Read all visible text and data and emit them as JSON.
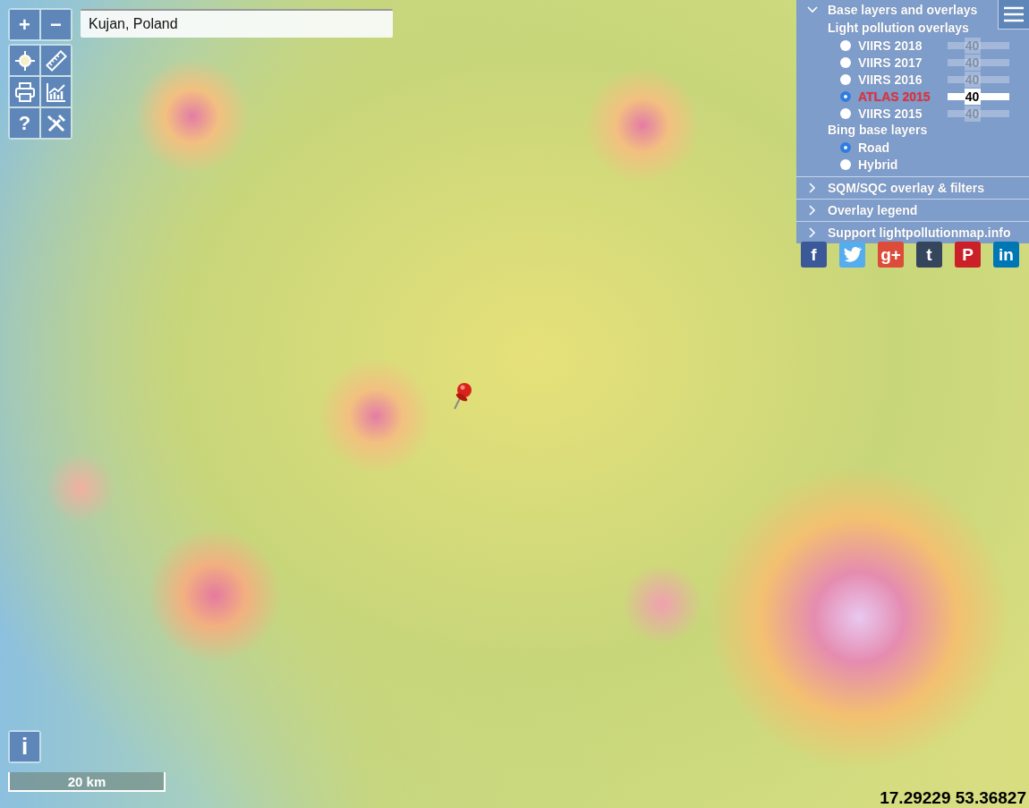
{
  "search": {
    "value": "Kujan, Poland"
  },
  "zoom": {
    "in_label": "+",
    "out_label": "−"
  },
  "tools": {
    "help_label": "?"
  },
  "info": {
    "label": "i"
  },
  "panel": {
    "sections": [
      {
        "title": "Base layers and overlays",
        "expanded": true
      },
      {
        "title": "SQM/SQC overlay & filters",
        "expanded": false
      },
      {
        "title": "Overlay legend",
        "expanded": false
      },
      {
        "title": "Support lightpollutionmap.info",
        "expanded": false
      }
    ],
    "overlays_heading": "Light pollution overlays",
    "overlays": [
      {
        "label": "VIIRS 2018",
        "selected": false,
        "reading": "40",
        "level": 0.4
      },
      {
        "label": "VIIRS 2017",
        "selected": false,
        "reading": "40",
        "level": 0.4
      },
      {
        "label": "VIIRS 2016",
        "selected": false,
        "reading": "40",
        "level": 0.4
      },
      {
        "label": "ATLAS 2015",
        "selected": true,
        "reading": "40",
        "level": 0.4
      },
      {
        "label": "VIIRS 2015",
        "selected": false,
        "reading": "40",
        "level": 0.4
      }
    ],
    "base_heading": "Bing base layers",
    "base_layers": [
      {
        "label": "Road",
        "selected": true
      },
      {
        "label": "Hybrid",
        "selected": false
      }
    ]
  },
  "social": [
    {
      "kind": "glyph",
      "glyph": "f",
      "color": "#3b5998"
    },
    {
      "kind": "bird",
      "color": "#55acee"
    },
    {
      "kind": "glyph",
      "glyph": "g+",
      "color": "#dd4b39"
    },
    {
      "kind": "glyph",
      "glyph": "t",
      "color": "#35465c"
    },
    {
      "kind": "glyph",
      "glyph": "P",
      "color": "#cb2027"
    },
    {
      "kind": "glyph",
      "glyph": "in",
      "color": "#0077b5"
    }
  ],
  "scale": {
    "label": "20 km"
  },
  "coordinates": "17.29229 53.36827"
}
